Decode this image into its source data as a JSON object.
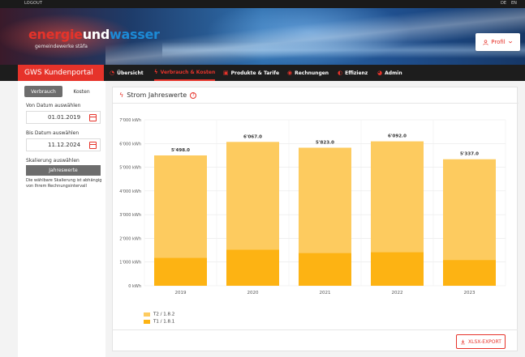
{
  "topbar": {
    "logout": "LOGOUT",
    "languages": [
      "DE",
      "EN"
    ]
  },
  "banner": {
    "logo_part1": "energie",
    "logo_part2": "und",
    "logo_part3": "wasser",
    "logo_sub": "gemeindewerke stäfa",
    "profile_label": "Profil"
  },
  "nav": {
    "brand": "GWS Kundenportal",
    "items": [
      {
        "label": "Übersicht",
        "icon": "gauge-icon"
      },
      {
        "label": "Verbrauch & Kosten",
        "icon": "bolt-icon",
        "active": true
      },
      {
        "label": "Produkte & Tarife",
        "icon": "box-icon"
      },
      {
        "label": "Rechnungen",
        "icon": "bill-icon"
      },
      {
        "label": "Effizienz",
        "icon": "leaf-icon"
      },
      {
        "label": "Admin",
        "icon": "user-icon"
      }
    ]
  },
  "sidebar": {
    "toggle": [
      "Verbrauch",
      "Kosten"
    ],
    "from_label": "Von Datum auswählen",
    "from_value": "01.01.2019",
    "to_label": "Bis Datum auswählen",
    "to_value": "11.12.2024",
    "scale_label": "Skalierung auswählen",
    "scale_value": "Jahreswerte",
    "scale_note": "Die wählbare Skalierung ist abhängig von Ihrem Rechnungsintervall"
  },
  "card": {
    "title": "Strom Jahreswerte",
    "help": "?"
  },
  "chart_data": {
    "type": "bar",
    "stacked": true,
    "categories": [
      "2019",
      "2020",
      "2021",
      "2022",
      "2023"
    ],
    "series": [
      {
        "name": "T1 / 1.8.1",
        "values": [
          1180,
          1520,
          1390,
          1420,
          1090
        ],
        "color": "#fdb313"
      },
      {
        "name": "T2 / 1.8.2",
        "values": [
          4318,
          4547,
          4433,
          4672,
          4247
        ],
        "color": "#fdcb5f"
      }
    ],
    "totals": [
      "5'498.0",
      "6'067.0",
      "5'823.0",
      "6'092.0",
      "5'337.0"
    ],
    "y_ticks": [
      "0 kWh",
      "1'000 kWh",
      "2'000 kWh",
      "3'000 kWh",
      "4'000 kWh",
      "5'000 kWh",
      "6'000 kWh",
      "7'000 kWh"
    ],
    "ylim": [
      0,
      7000
    ],
    "grid": true,
    "legend_position": "bottom-left"
  },
  "export_label": "XLSX-EXPORT",
  "colors": {
    "accent": "#e6332a",
    "dark": "#1d1d1d"
  }
}
